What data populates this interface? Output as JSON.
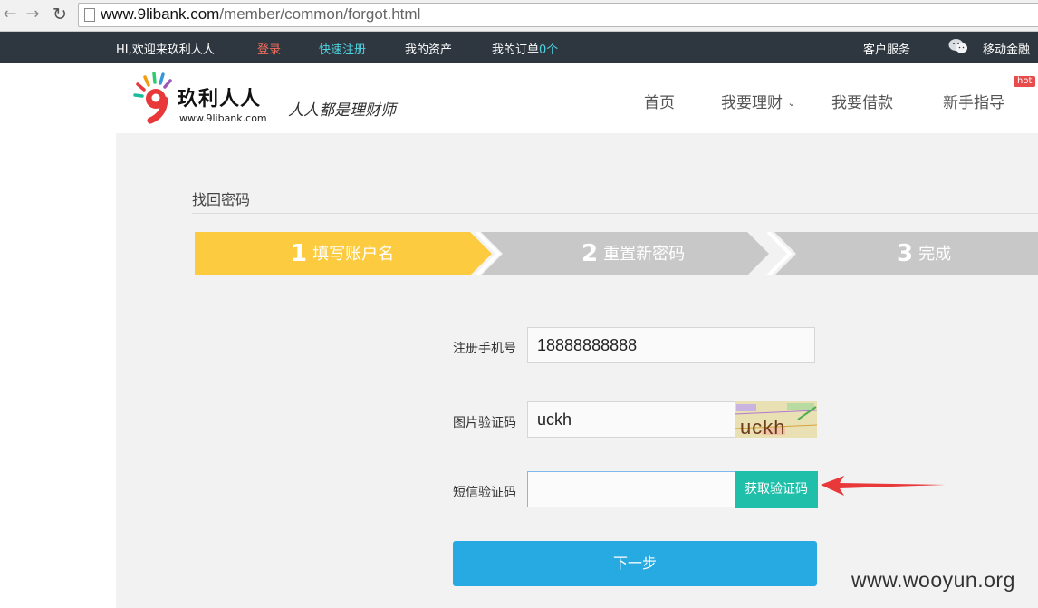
{
  "browser": {
    "url_host": "www.9libank.com",
    "url_path": "/member/common/forgot.html",
    "icons": [
      "back-arrow-icon",
      "forward-arrow-icon",
      "reload-icon",
      "page-icon"
    ]
  },
  "topbar": {
    "welcome": "HI,欢迎来玖利人人",
    "login": "登录",
    "register": "快速注册",
    "assets": "我的资产",
    "orders": "我的订单",
    "orders_count": "0个",
    "service": "客户服务",
    "mobile": "移动金融",
    "colors": {
      "background": "#2e3740",
      "login": "#f06c5b",
      "register": "#4fd2e0"
    }
  },
  "header": {
    "logo_title": "玖利人人",
    "logo_url": "www.9libank.com",
    "slogan": "人人都是理财师",
    "nav": {
      "home": "首页",
      "invest": "我要理财",
      "borrow": "我要借款",
      "guide": "新手指导",
      "hot_badge": "hot"
    }
  },
  "main": {
    "title": "找回密码",
    "steps": [
      {
        "number": "1",
        "label": "填写账户名",
        "active": true
      },
      {
        "number": "2",
        "label": "重置新密码",
        "active": false
      },
      {
        "number": "3",
        "label": "完成",
        "active": false
      }
    ],
    "form": {
      "phone_label": "注册手机号",
      "phone_value": "18888888888",
      "image_code_label": "图片验证码",
      "image_code_value": "uckh",
      "captcha_text": "uckh",
      "sms_label": "短信验证码",
      "sms_value": "",
      "get_code_button": "获取验证码",
      "next_button": "下一步"
    },
    "colors": {
      "step_active": "#fdcb3f",
      "step_inactive": "#c8c8c8",
      "get_code": "#1fbfaa",
      "next": "#27a9e1",
      "annotation_arrow": "#e8383a"
    }
  },
  "watermark": "www.wooyun.org"
}
